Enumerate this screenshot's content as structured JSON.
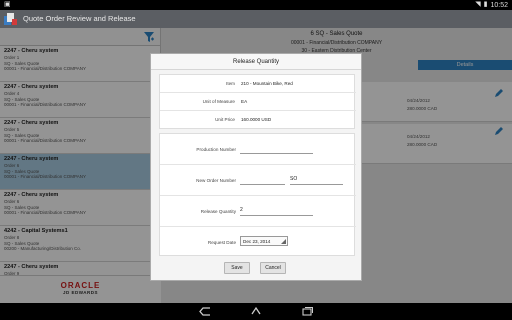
{
  "status_bar": {
    "time": "10:52"
  },
  "app": {
    "title": "Quote Order Review and Release"
  },
  "left_list": {
    "items": [
      {
        "title": "2247 - Cheru system",
        "lines": [
          "Order 1",
          "SQ - Sales Quote",
          "00001 - Financial/Distribution COMPANY"
        ],
        "selected": false
      },
      {
        "title": "2247 - Cheru system",
        "lines": [
          "Order 4",
          "SQ - Sales Quote",
          "00001 - Financial/Distribution COMPANY"
        ],
        "selected": false
      },
      {
        "title": "2247 - Cheru system",
        "lines": [
          "Order 5",
          "SQ - Sales Quote",
          "00001 - Financial/Distribution COMPANY"
        ],
        "selected": false
      },
      {
        "title": "2247 - Cheru system",
        "lines": [
          "Order 6",
          "SQ - Sales Quote",
          "00001 - Financial/Distribution COMPANY"
        ],
        "selected": true
      },
      {
        "title": "2247 - Cheru system",
        "lines": [
          "Order 6",
          "SQ - Sales Quote",
          "00001 - Financial/Distribution COMPANY"
        ],
        "selected": false
      },
      {
        "title": "4242 - Capital Systems1",
        "lines": [
          "Order 8",
          "SQ - Sales Quote",
          "00200 - Manufacturing/Distribution Co."
        ],
        "selected": false
      },
      {
        "title": "2247 - Cheru system",
        "lines": [
          "Order 9",
          "SQ - Sales Quote",
          "00001 - Financial/Distribution COMPANY"
        ],
        "selected": false
      }
    ]
  },
  "footer": {
    "oracle": "ORACLE",
    "jde": "JD EDWARDS"
  },
  "detail": {
    "title": "6 SQ - Sales Quote",
    "company": "00001 - Financial/Distribution COMPANY",
    "center": "30 - Eastern Distribution Center",
    "details_tab": "Details",
    "rows": [
      {
        "date": "04/24/2012",
        "amount": "280.0000 CAD"
      },
      {
        "date": "04/24/2012",
        "amount": "280.0000 CAD"
      }
    ]
  },
  "dialog": {
    "title": "Release Quantity",
    "info": [
      {
        "label": "Item",
        "value": "210 - Mountain Bike, Red"
      },
      {
        "label": "Unit of Measure",
        "value": "EA"
      },
      {
        "label": "Unit Price",
        "value": "160.0000 USD"
      }
    ],
    "production_number_label": "Production Number",
    "production_number_value": "",
    "new_order_number_label": "New Order Number",
    "new_order_number_value": "",
    "new_order_type_value": "SO",
    "release_quantity_label": "Release Quantity",
    "release_quantity_value": "2",
    "request_date_label": "Request Date",
    "request_date_value": "Dec 23, 2014",
    "save_label": "Save",
    "cancel_label": "Cancel"
  }
}
